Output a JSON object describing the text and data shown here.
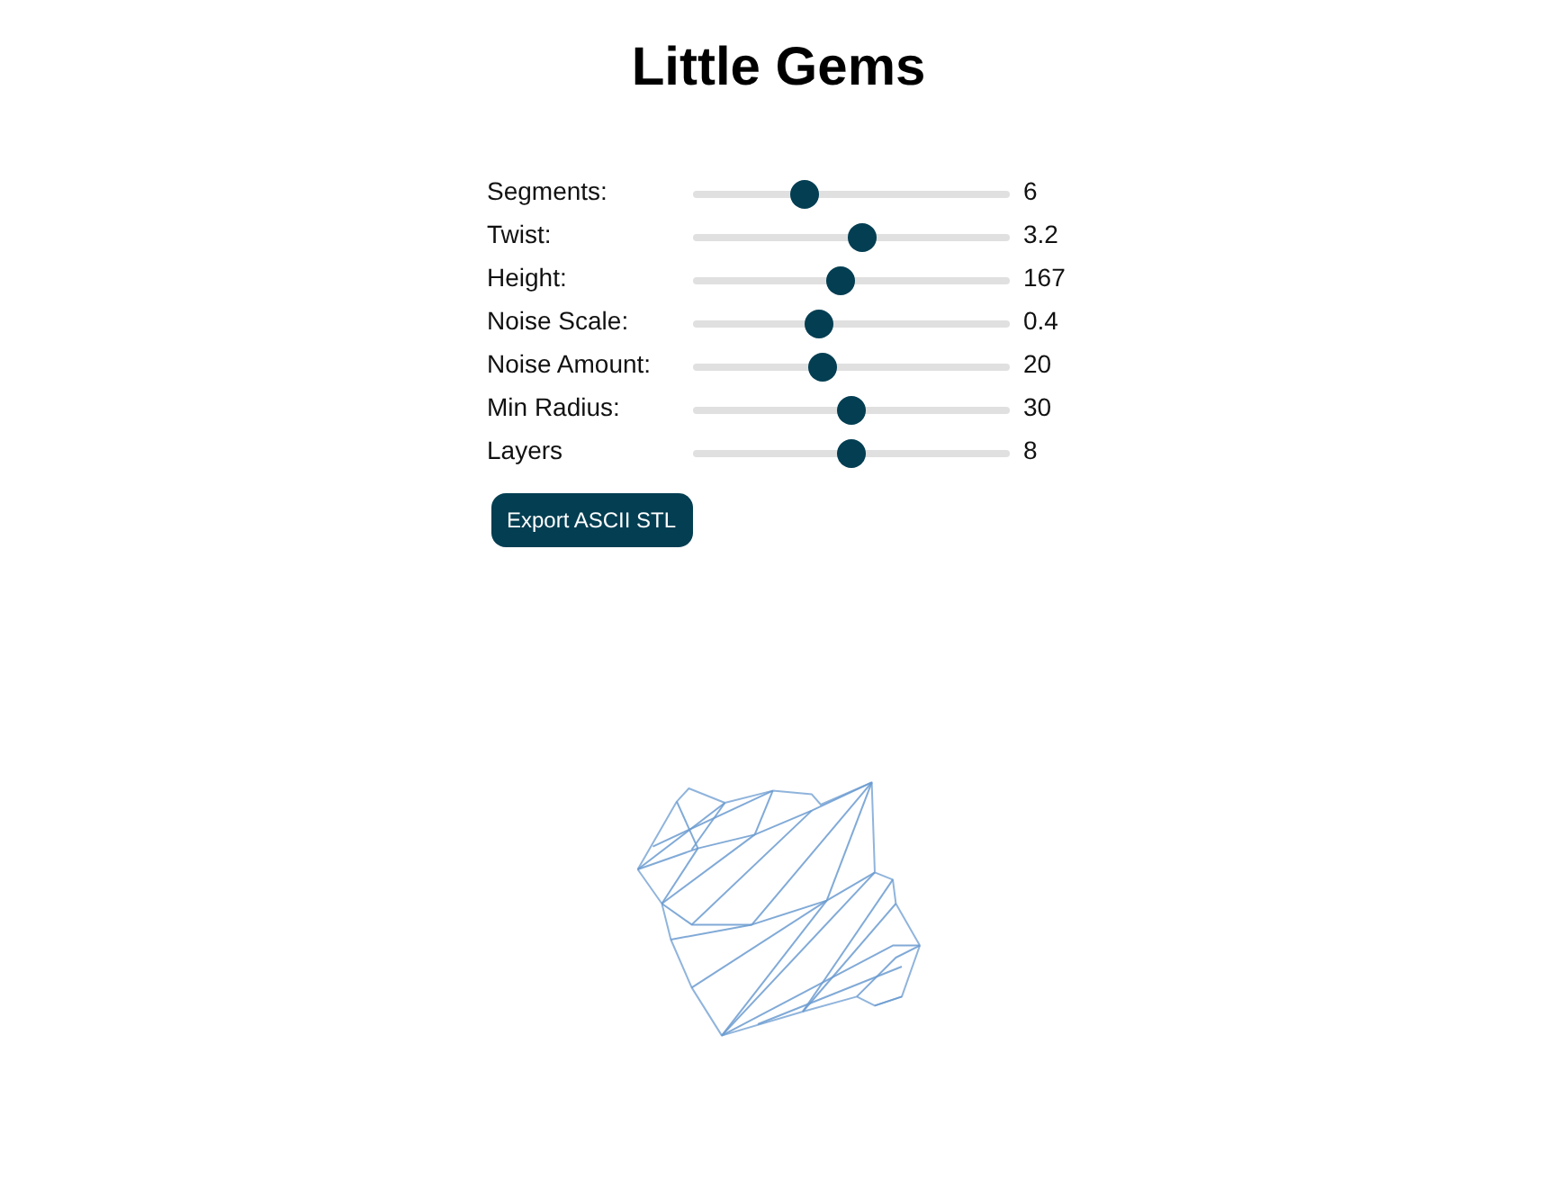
{
  "title": "Little Gems",
  "sliders": [
    {
      "label": "Segments:",
      "value": "6",
      "level": 0.34
    },
    {
      "label": "Twist:",
      "value": "3.2",
      "level": 0.54
    },
    {
      "label": "Height:",
      "value": "167",
      "level": 0.465
    },
    {
      "label": "Noise Scale:",
      "value": "0.4",
      "level": 0.39
    },
    {
      "label": "Noise Amount:",
      "value": "20",
      "level": 0.4
    },
    {
      "label": "Min Radius:",
      "value": "30",
      "level": 0.5
    },
    {
      "label": "Layers",
      "value": "8",
      "level": 0.5
    }
  ],
  "export_button": {
    "label": "Export ASCII STL"
  }
}
